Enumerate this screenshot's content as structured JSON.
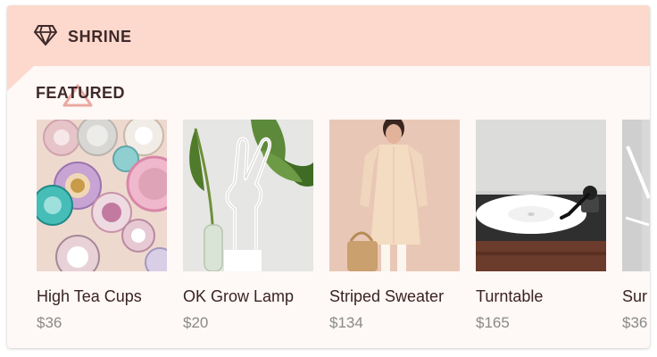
{
  "app": {
    "title": "SHRINE",
    "logo_icon": "diamond-icon",
    "colors": {
      "app_bar": "#fdd8cc",
      "background": "#fef8f6",
      "text_primary": "#3f2a2a",
      "text_secondary": "#8a8a8a",
      "accent_triangle": "#e59a91"
    }
  },
  "section": {
    "title": "FEATURED"
  },
  "products": [
    {
      "name": "High Tea Cups",
      "price": "$36"
    },
    {
      "name": "OK Grow Lamp",
      "price": "$20"
    },
    {
      "name": "Striped Sweater",
      "price": "$134"
    },
    {
      "name": "Turntable",
      "price": "$165"
    },
    {
      "name": "Sur",
      "price": "$36"
    }
  ]
}
